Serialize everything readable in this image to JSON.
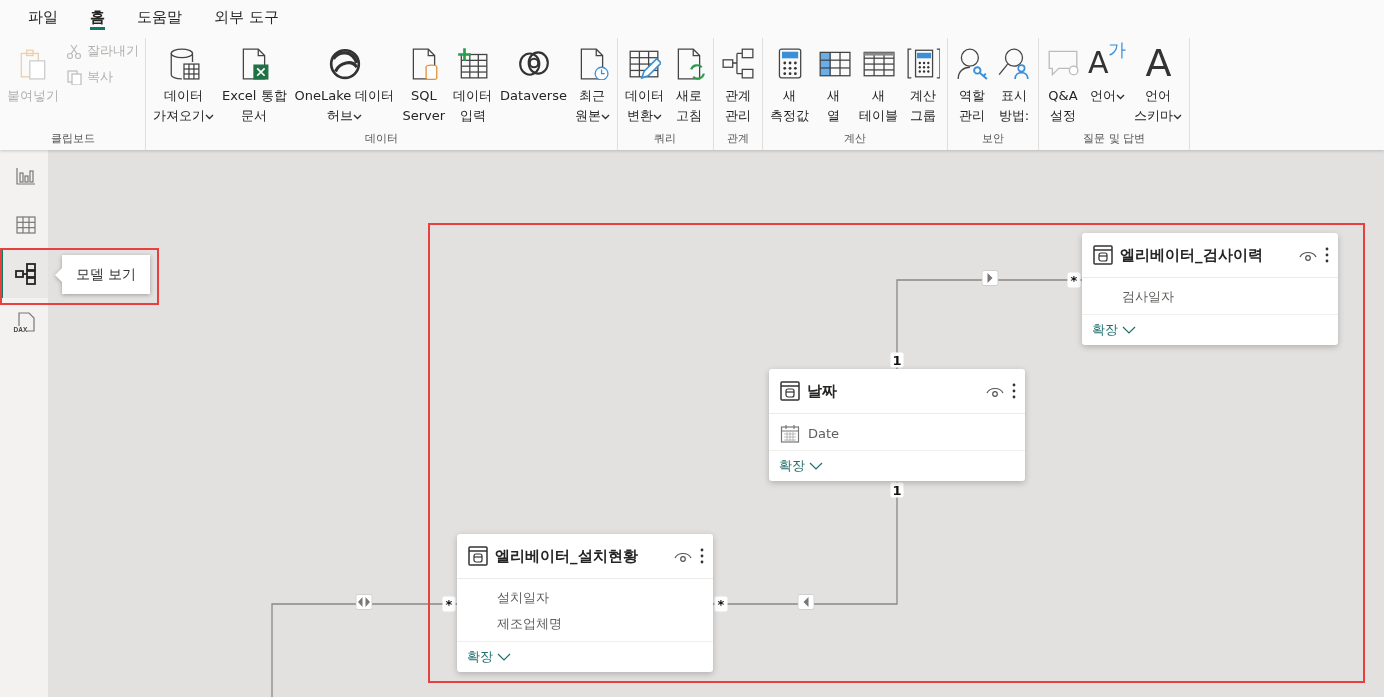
{
  "tabs": [
    {
      "label": "파일",
      "selected": false
    },
    {
      "label": "홈",
      "selected": true
    },
    {
      "label": "도움말",
      "selected": false
    },
    {
      "label": "외부 도구",
      "selected": false
    }
  ],
  "ribbon": {
    "groups": [
      {
        "label": "클립보드",
        "buttons": [
          {
            "lines": [
              "붙여넣기"
            ],
            "kind": "large",
            "disabled": true,
            "dropdown": false
          },
          {
            "lines": [
              "잘라내기"
            ],
            "kind": "small",
            "disabled": true,
            "dropdown": false
          },
          {
            "lines": [
              "복사"
            ],
            "kind": "small",
            "disabled": true,
            "dropdown": false
          }
        ]
      },
      {
        "label": "데이터",
        "buttons": [
          {
            "lines": [
              "데이터",
              "가져오기"
            ],
            "kind": "large",
            "disabled": false,
            "dropdown": true
          },
          {
            "lines": [
              "Excel 통합",
              "문서"
            ],
            "kind": "large",
            "disabled": false,
            "dropdown": false
          },
          {
            "lines": [
              "OneLake 데이터",
              "허브"
            ],
            "kind": "large",
            "disabled": false,
            "dropdown": true
          },
          {
            "lines": [
              "SQL",
              "Server"
            ],
            "kind": "large",
            "disabled": false,
            "dropdown": false
          },
          {
            "lines": [
              "데이터",
              "입력"
            ],
            "kind": "large",
            "disabled": false,
            "dropdown": false
          },
          {
            "lines": [
              "Dataverse"
            ],
            "kind": "large",
            "disabled": false,
            "dropdown": false
          },
          {
            "lines": [
              "최근",
              "원본"
            ],
            "kind": "large",
            "disabled": false,
            "dropdown": true
          }
        ]
      },
      {
        "label": "쿼리",
        "buttons": [
          {
            "lines": [
              "데이터",
              "변환"
            ],
            "kind": "large",
            "disabled": false,
            "dropdown": true
          },
          {
            "lines": [
              "새로",
              "고침"
            ],
            "kind": "large",
            "disabled": false,
            "dropdown": false
          }
        ]
      },
      {
        "label": "관계",
        "buttons": [
          {
            "lines": [
              "관계",
              "관리"
            ],
            "kind": "large",
            "disabled": false,
            "dropdown": false
          }
        ]
      },
      {
        "label": "계산",
        "buttons": [
          {
            "lines": [
              "새",
              "측정값"
            ],
            "kind": "large",
            "disabled": false,
            "dropdown": false
          },
          {
            "lines": [
              "새",
              "열"
            ],
            "kind": "large",
            "disabled": false,
            "dropdown": false
          },
          {
            "lines": [
              "새",
              "테이블"
            ],
            "kind": "large",
            "disabled": false,
            "dropdown": false
          },
          {
            "lines": [
              "계산",
              "그룹"
            ],
            "kind": "large",
            "disabled": false,
            "dropdown": false
          }
        ]
      },
      {
        "label": "보안",
        "buttons": [
          {
            "lines": [
              "역할",
              "관리"
            ],
            "kind": "large",
            "disabled": false,
            "dropdown": false
          },
          {
            "lines": [
              "표시",
              "방법:"
            ],
            "kind": "large",
            "disabled": false,
            "dropdown": false
          }
        ]
      },
      {
        "label": "질문 및 답변",
        "buttons": [
          {
            "lines": [
              "Q&A",
              "설정"
            ],
            "kind": "large",
            "disabled": false,
            "dropdown": false
          },
          {
            "lines": [
              "언어"
            ],
            "kind": "large",
            "disabled": false,
            "dropdown": true,
            "glyph": "A",
            "glyph_sup": "가"
          },
          {
            "lines": [
              "언어",
              "스키마"
            ],
            "kind": "large",
            "disabled": false,
            "dropdown": true,
            "glyph": "A"
          }
        ]
      }
    ]
  },
  "nav": {
    "items": [
      {
        "selected": false
      },
      {
        "selected": false
      },
      {
        "selected": true
      },
      {
        "selected": false,
        "glyph": "DAX"
      }
    ],
    "tooltip": "모델 보기",
    "highlighted": true
  },
  "tables": [
    {
      "name": "엘리베이터_검사이력",
      "fields": [
        {
          "name": "검사일자",
          "kind": "text"
        }
      ],
      "expand": "확장"
    },
    {
      "name": "날짜",
      "fields": [
        {
          "name": "Date",
          "kind": "date"
        }
      ],
      "expand": "확장"
    },
    {
      "name": "엘리베이터_설치현황",
      "fields": [
        {
          "name": "설치일자",
          "kind": "text"
        },
        {
          "name": "제조업체명",
          "kind": "text"
        }
      ],
      "expand": "확장"
    }
  ],
  "relationships": [
    {
      "end_a": "1",
      "end_b": "*",
      "kind": "single"
    },
    {
      "end_b": "*",
      "kind": "both"
    },
    {
      "end_a": "1",
      "end_b": "*",
      "kind": "single"
    }
  ],
  "diagram_highlighted": true
}
